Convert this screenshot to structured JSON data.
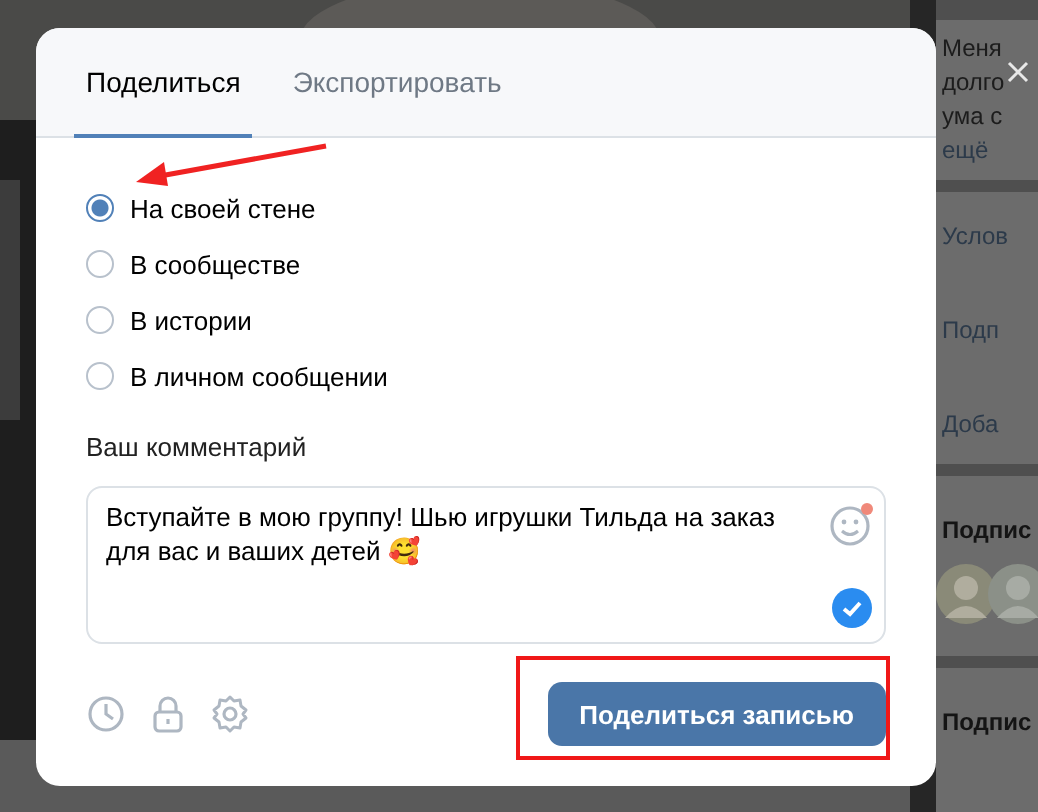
{
  "background": {
    "side_texts": [
      "Меня",
      "долго",
      "ума с",
      "ещё",
      "Услов",
      "Подп",
      "Доба"
    ],
    "side_headings": [
      "Подпис",
      "Подпис"
    ]
  },
  "tabs": [
    {
      "label": "Поделиться",
      "selected": true
    },
    {
      "label": "Экспортировать",
      "selected": false
    }
  ],
  "targets": [
    {
      "label": "На своей стене",
      "selected": true
    },
    {
      "label": "В сообществе",
      "selected": false
    },
    {
      "label": "В истории",
      "selected": false
    },
    {
      "label": "В личном сообщении",
      "selected": false
    }
  ],
  "comment": {
    "label": "Ваш комментарий",
    "value": "Вступайте в мою группу! Шью игрушки Тильда на заказ для вас и ваших детей 🥰",
    "emoji_badge": true,
    "ready": true
  },
  "submit": "Поделиться записью"
}
